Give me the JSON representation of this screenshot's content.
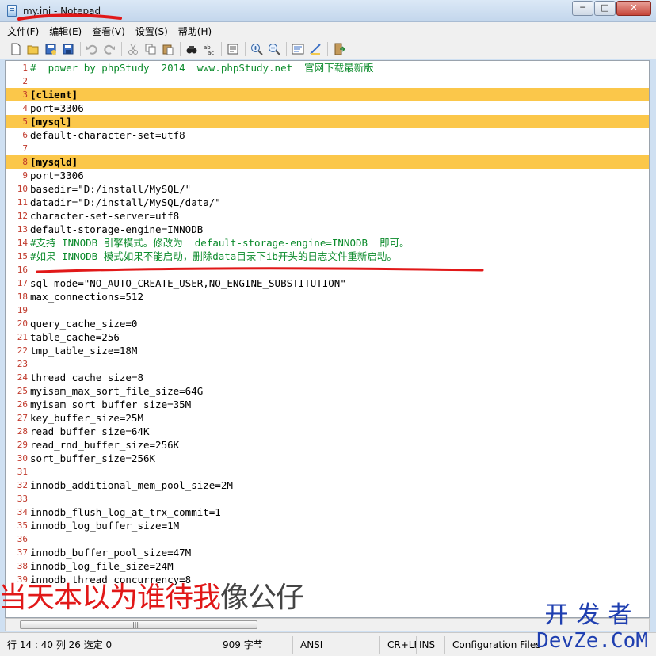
{
  "window": {
    "title": "my.ini - Notepad",
    "buttons": {
      "minimize": "─",
      "maximize": "□",
      "close": "✕"
    }
  },
  "menu": [
    "文件(F)",
    "编辑(E)",
    "查看(V)",
    "设置(S)",
    "帮助(H)"
  ],
  "toolbar_icons": [
    "new-icon",
    "open-icon",
    "save-as-icon",
    "save-icon",
    "undo-icon",
    "redo-icon",
    "cut-icon",
    "copy-icon",
    "paste-icon",
    "find-icon",
    "replace-icon",
    "goto-icon",
    "zoom-in-icon",
    "zoom-out-icon",
    "wordwrap-icon",
    "font-icon",
    "exit-icon"
  ],
  "editor": {
    "lines": [
      {
        "n": "1",
        "text": "#  power by phpStudy  2014  www.phpStudy.net  官网下载最新版",
        "type": "comment",
        "hl": false
      },
      {
        "n": "2",
        "text": "",
        "type": "normal",
        "hl": false
      },
      {
        "n": "3",
        "text": "[client]",
        "type": "section",
        "hl": true
      },
      {
        "n": "4",
        "text": "port=3306",
        "type": "normal",
        "hl": false
      },
      {
        "n": "5",
        "text": "[mysql]",
        "type": "section",
        "hl": true
      },
      {
        "n": "6",
        "text": "default-character-set=utf8",
        "type": "normal",
        "hl": false
      },
      {
        "n": "7",
        "text": "",
        "type": "normal",
        "hl": false
      },
      {
        "n": "8",
        "text": "[mysqld]",
        "type": "section",
        "hl": true
      },
      {
        "n": "9",
        "text": "port=3306",
        "type": "normal",
        "hl": false
      },
      {
        "n": "10",
        "text": "basedir=\"D:/install/MySQL/\"",
        "type": "normal",
        "hl": false
      },
      {
        "n": "11",
        "text": "datadir=\"D:/install/MySQL/data/\"",
        "type": "normal",
        "hl": false
      },
      {
        "n": "12",
        "text": "character-set-server=utf8",
        "type": "normal",
        "hl": false
      },
      {
        "n": "13",
        "text": "default-storage-engine=INNODB",
        "type": "normal",
        "hl": false
      },
      {
        "n": "14",
        "text": "#支持 INNODB 引擎模式。修改为  default-storage-engine=INNODB  即可。",
        "type": "comment",
        "hl": false
      },
      {
        "n": "15",
        "text": "#如果 INNODB 模式如果不能启动，删除data目录下ib开头的日志文件重新启动。",
        "type": "comment",
        "hl": false
      },
      {
        "n": "16",
        "text": "",
        "type": "normal",
        "hl": false
      },
      {
        "n": "17",
        "text": "sql-mode=\"NO_AUTO_CREATE_USER,NO_ENGINE_SUBSTITUTION\"",
        "type": "normal",
        "hl": false
      },
      {
        "n": "18",
        "text": "max_connections=512",
        "type": "normal",
        "hl": false
      },
      {
        "n": "19",
        "text": "",
        "type": "normal",
        "hl": false
      },
      {
        "n": "20",
        "text": "query_cache_size=0",
        "type": "normal",
        "hl": false
      },
      {
        "n": "21",
        "text": "table_cache=256",
        "type": "normal",
        "hl": false
      },
      {
        "n": "22",
        "text": "tmp_table_size=18M",
        "type": "normal",
        "hl": false
      },
      {
        "n": "23",
        "text": "",
        "type": "normal",
        "hl": false
      },
      {
        "n": "24",
        "text": "thread_cache_size=8",
        "type": "normal",
        "hl": false
      },
      {
        "n": "25",
        "text": "myisam_max_sort_file_size=64G",
        "type": "normal",
        "hl": false
      },
      {
        "n": "26",
        "text": "myisam_sort_buffer_size=35M",
        "type": "normal",
        "hl": false
      },
      {
        "n": "27",
        "text": "key_buffer_size=25M",
        "type": "normal",
        "hl": false
      },
      {
        "n": "28",
        "text": "read_buffer_size=64K",
        "type": "normal",
        "hl": false
      },
      {
        "n": "29",
        "text": "read_rnd_buffer_size=256K",
        "type": "normal",
        "hl": false
      },
      {
        "n": "30",
        "text": "sort_buffer_size=256K",
        "type": "normal",
        "hl": false
      },
      {
        "n": "31",
        "text": "",
        "type": "normal",
        "hl": false
      },
      {
        "n": "32",
        "text": "innodb_additional_mem_pool_size=2M",
        "type": "normal",
        "hl": false
      },
      {
        "n": "33",
        "text": "",
        "type": "normal",
        "hl": false
      },
      {
        "n": "34",
        "text": "innodb_flush_log_at_trx_commit=1",
        "type": "normal",
        "hl": false
      },
      {
        "n": "35",
        "text": "innodb_log_buffer_size=1M",
        "type": "normal",
        "hl": false
      },
      {
        "n": "36",
        "text": "",
        "type": "normal",
        "hl": false
      },
      {
        "n": "37",
        "text": "innodb_buffer_pool_size=47M",
        "type": "normal",
        "hl": false
      },
      {
        "n": "38",
        "text": "innodb_log_file_size=24M",
        "type": "normal",
        "hl": false
      },
      {
        "n": "39",
        "text": "innodb_thread_concurrency=8",
        "type": "normal",
        "hl": false
      }
    ]
  },
  "status": {
    "position": "行 14 : 40  列 26  选定 0",
    "size": "909 字节",
    "encoding": "ANSI",
    "eol": "CR+LF",
    "mode": "INS",
    "filetype": "Configuration Files"
  },
  "overlay": {
    "caption_red": "当天本以为谁待我",
    "caption_gray": "像公仔"
  },
  "watermark": {
    "cn": "开发者",
    "en": "DevZe.CoM"
  },
  "colors": {
    "highlight": "#fbc74a",
    "line_number": "#c0392b",
    "comment": "#0a8a2a",
    "annotation": "#e11818"
  }
}
